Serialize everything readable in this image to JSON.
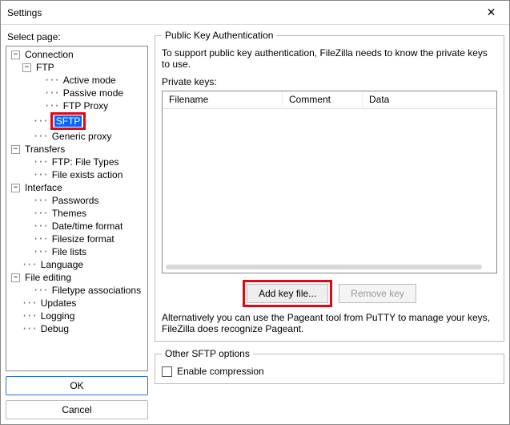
{
  "window": {
    "title": "Settings"
  },
  "left": {
    "label": "Select page:",
    "ok": "OK",
    "cancel": "Cancel"
  },
  "tree": {
    "connection": "Connection",
    "ftp": "FTP",
    "active": "Active mode",
    "passive": "Passive mode",
    "ftpproxy": "FTP Proxy",
    "sftp": "SFTP",
    "genericproxy": "Generic proxy",
    "transfers": "Transfers",
    "filetypes": "FTP: File Types",
    "fileexists": "File exists action",
    "interface": "Interface",
    "passwords": "Passwords",
    "themes": "Themes",
    "datetime": "Date/time format",
    "filesize": "Filesize format",
    "filelists": "File lists",
    "language": "Language",
    "fileediting": "File editing",
    "filetypeassoc": "Filetype associations",
    "updates": "Updates",
    "logging": "Logging",
    "debug": "Debug"
  },
  "pka": {
    "legend": "Public Key Authentication",
    "desc": "To support public key authentication, FileZilla needs to know the private keys to use.",
    "private_label": "Private keys:",
    "col_filename": "Filename",
    "col_comment": "Comment",
    "col_data": "Data",
    "add_key": "Add key file...",
    "remove_key": "Remove key",
    "alt": "Alternatively you can use the Pageant tool from PuTTY to manage your keys, FileZilla does recognize Pageant."
  },
  "other": {
    "legend": "Other SFTP options",
    "enable_compression": "Enable compression"
  }
}
